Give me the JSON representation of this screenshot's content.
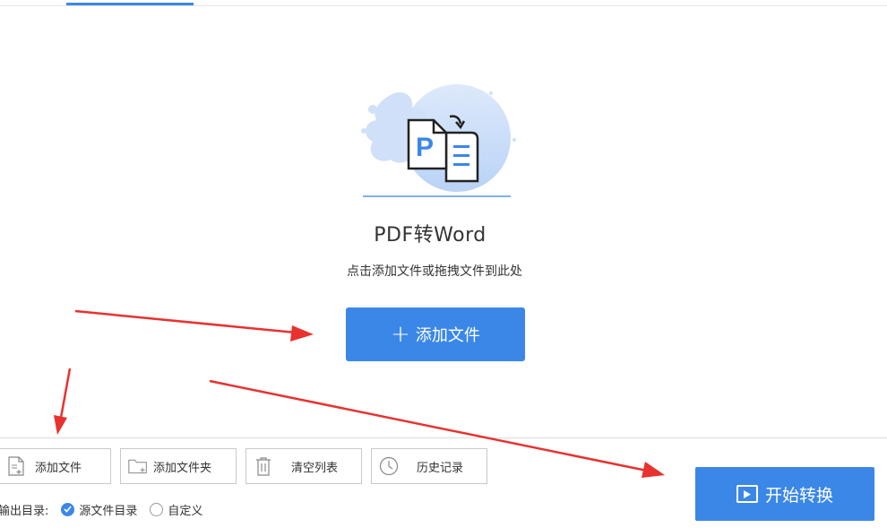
{
  "header": {
    "active_tab_indicator": "blue-underline"
  },
  "main": {
    "title": "PDF转Word",
    "subtitle": "点击添加文件或拖拽文件到此处",
    "add_button": {
      "label": "添加文件",
      "icon": "plus-icon"
    }
  },
  "toolbar": {
    "buttons": [
      {
        "label": "添加文件",
        "icon": "add-file-icon"
      },
      {
        "label": "添加文件夹",
        "icon": "add-folder-icon"
      },
      {
        "label": "清空列表",
        "icon": "trash-icon"
      },
      {
        "label": "历史记录",
        "icon": "clock-icon"
      }
    ]
  },
  "output": {
    "label": "输出目录:",
    "options": [
      {
        "label": "源文件目录",
        "selected": true
      },
      {
        "label": "自定义",
        "selected": false
      }
    ]
  },
  "start_button": {
    "label": "开始转换",
    "icon": "play-icon"
  },
  "colors": {
    "accent": "#3b87e8",
    "annotation_arrow": "#e8322f"
  }
}
